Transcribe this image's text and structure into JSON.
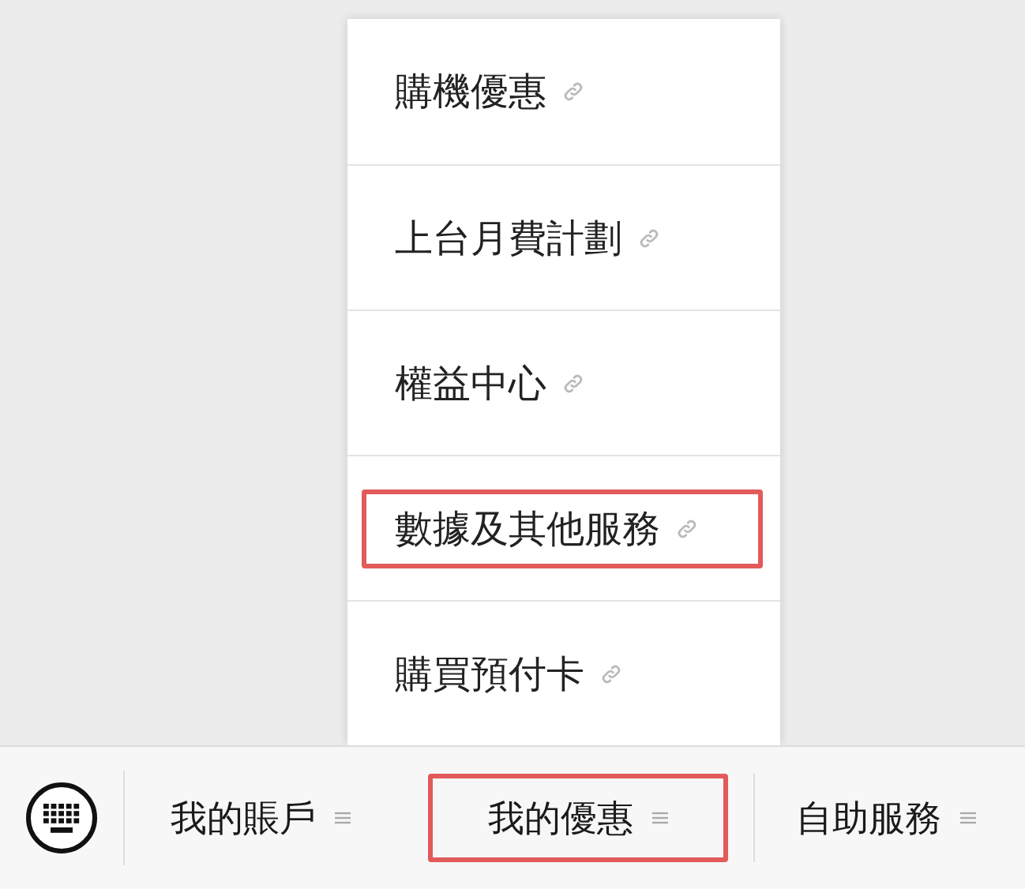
{
  "menu": {
    "items": [
      {
        "label": "購機優惠",
        "highlighted": false
      },
      {
        "label": "上台月費計劃",
        "highlighted": false
      },
      {
        "label": "權益中心",
        "highlighted": false
      },
      {
        "label": "數據及其他服務",
        "highlighted": true
      },
      {
        "label": "購買預付卡",
        "highlighted": false
      }
    ]
  },
  "tab_bar": {
    "tabs": [
      {
        "label": "我的賬戶",
        "selected": false
      },
      {
        "label": "我的優惠",
        "selected": true
      },
      {
        "label": "自助服務",
        "selected": false
      }
    ]
  }
}
